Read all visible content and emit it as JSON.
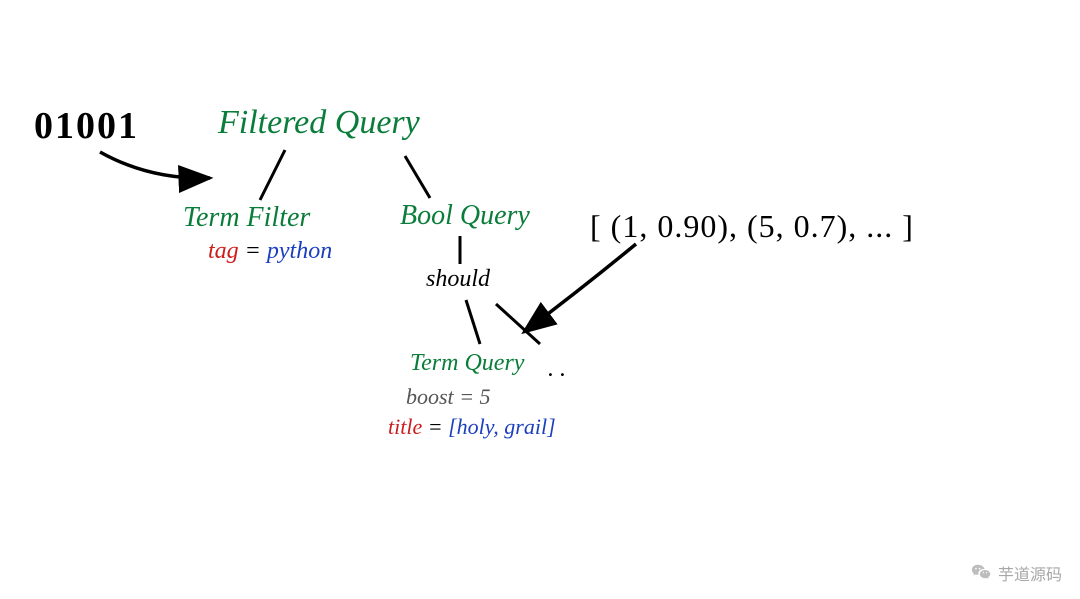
{
  "input_bits": "01001",
  "nodes": {
    "filtered_query": "Filtered Query",
    "term_filter": "Term Filter",
    "bool_query": "Bool Query",
    "should": "should",
    "term_query": "Term Query",
    "ellipsis": ". ."
  },
  "term_filter_kv": {
    "key": "tag",
    "eq": " = ",
    "value": "python"
  },
  "term_query_boost": {
    "key": "boost",
    "eq": " = ",
    "value": "5"
  },
  "term_query_title": {
    "key": "title",
    "eq": " = ",
    "value": "[holy, grail]"
  },
  "results_tuple": "[ (1, 0.90), (5, 0.7), ... ]",
  "watermark_text": "芋道源码"
}
